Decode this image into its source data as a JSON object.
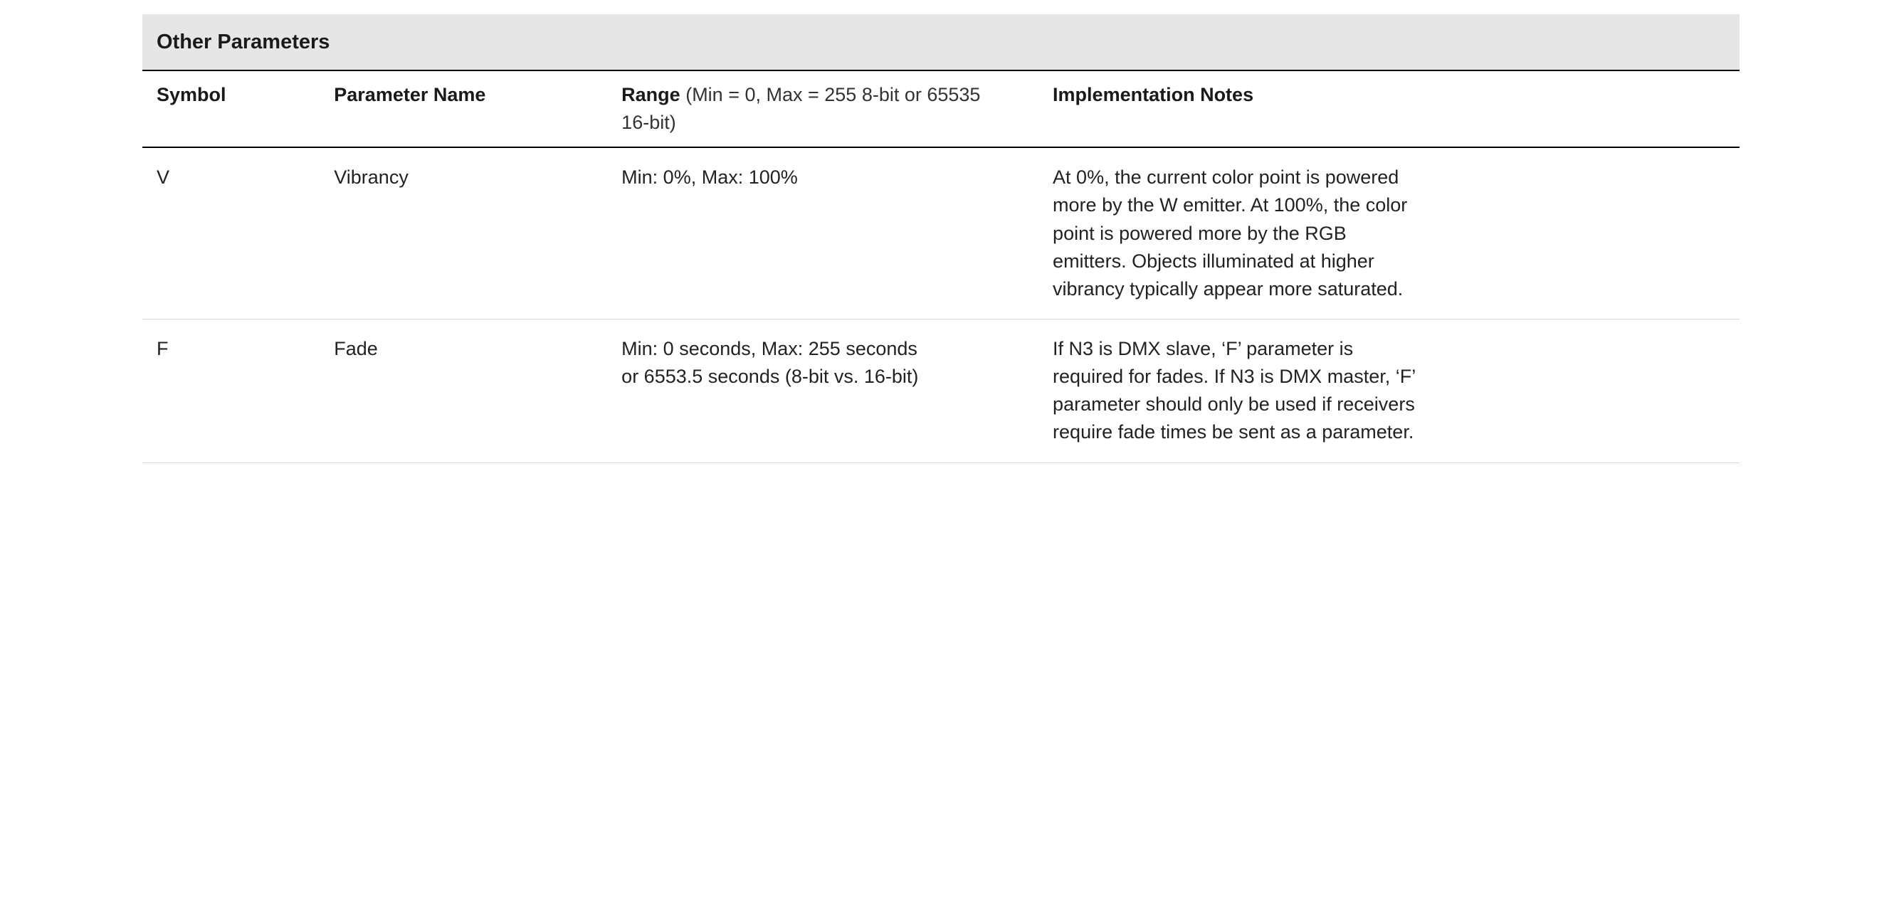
{
  "table": {
    "title": "Other Parameters",
    "headers": {
      "symbol": "Symbol",
      "param_name": "Parameter Name",
      "range_label": "Range",
      "range_sub": " (Min = 0, Max = 255 8‑bit or 65535 16‑bit)",
      "notes": "Implementation Notes"
    },
    "rows": [
      {
        "symbol": "V",
        "param_name": "Vibrancy",
        "range": "Min: 0%, Max: 100%",
        "notes": "At 0%, the current color point is powered more by the W emitter. At 100%, the color point is powered more by the RGB emitters. Objects illuminated at higher vibrancy typically appear more saturated."
      },
      {
        "symbol": "F",
        "param_name": "Fade",
        "range": "Min: 0 seconds, Max: 255 seconds or 6553.5 seconds (8‑bit vs. 16‑bit)",
        "notes": "If N3 is DMX slave, ‘F’ parameter is required for fades. If N3 is DMX master, ‘F’ parameter should only be used if receivers require fade times be sent as a parameter."
      }
    ]
  }
}
